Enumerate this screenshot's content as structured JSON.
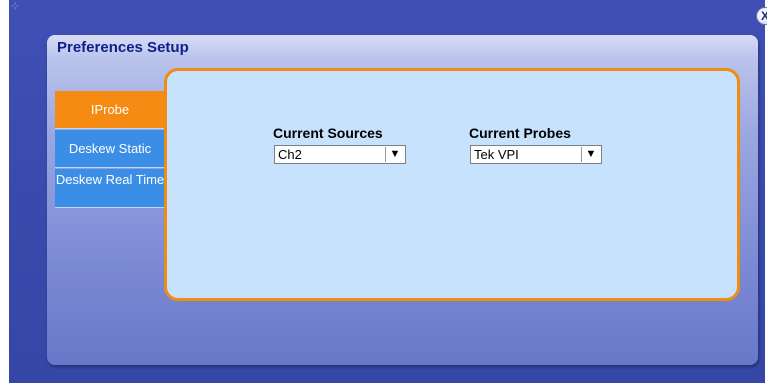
{
  "window": {
    "corner_icon": "move-handle-icon",
    "close_label": "X"
  },
  "dialog": {
    "title": "Preferences Setup"
  },
  "tabs": [
    {
      "label": "IProbe",
      "active": true
    },
    {
      "label": "Deskew Static",
      "active": false
    },
    {
      "label": "Deskew Real Time",
      "active": false
    }
  ],
  "fields": {
    "current_sources": {
      "label": "Current Sources",
      "value": "Ch2",
      "arrow": "▼"
    },
    "current_probes": {
      "label": "Current Probes",
      "value": "Tek VPI",
      "arrow": "▼"
    }
  },
  "colors": {
    "window_bg": "#3f4fb3",
    "title_text": "#0e1f8a",
    "tab_active": "#f68b13",
    "tab_inactive": "#3b8ee6",
    "content_bg": "#c6e2fc",
    "content_border": "#f08c12"
  }
}
